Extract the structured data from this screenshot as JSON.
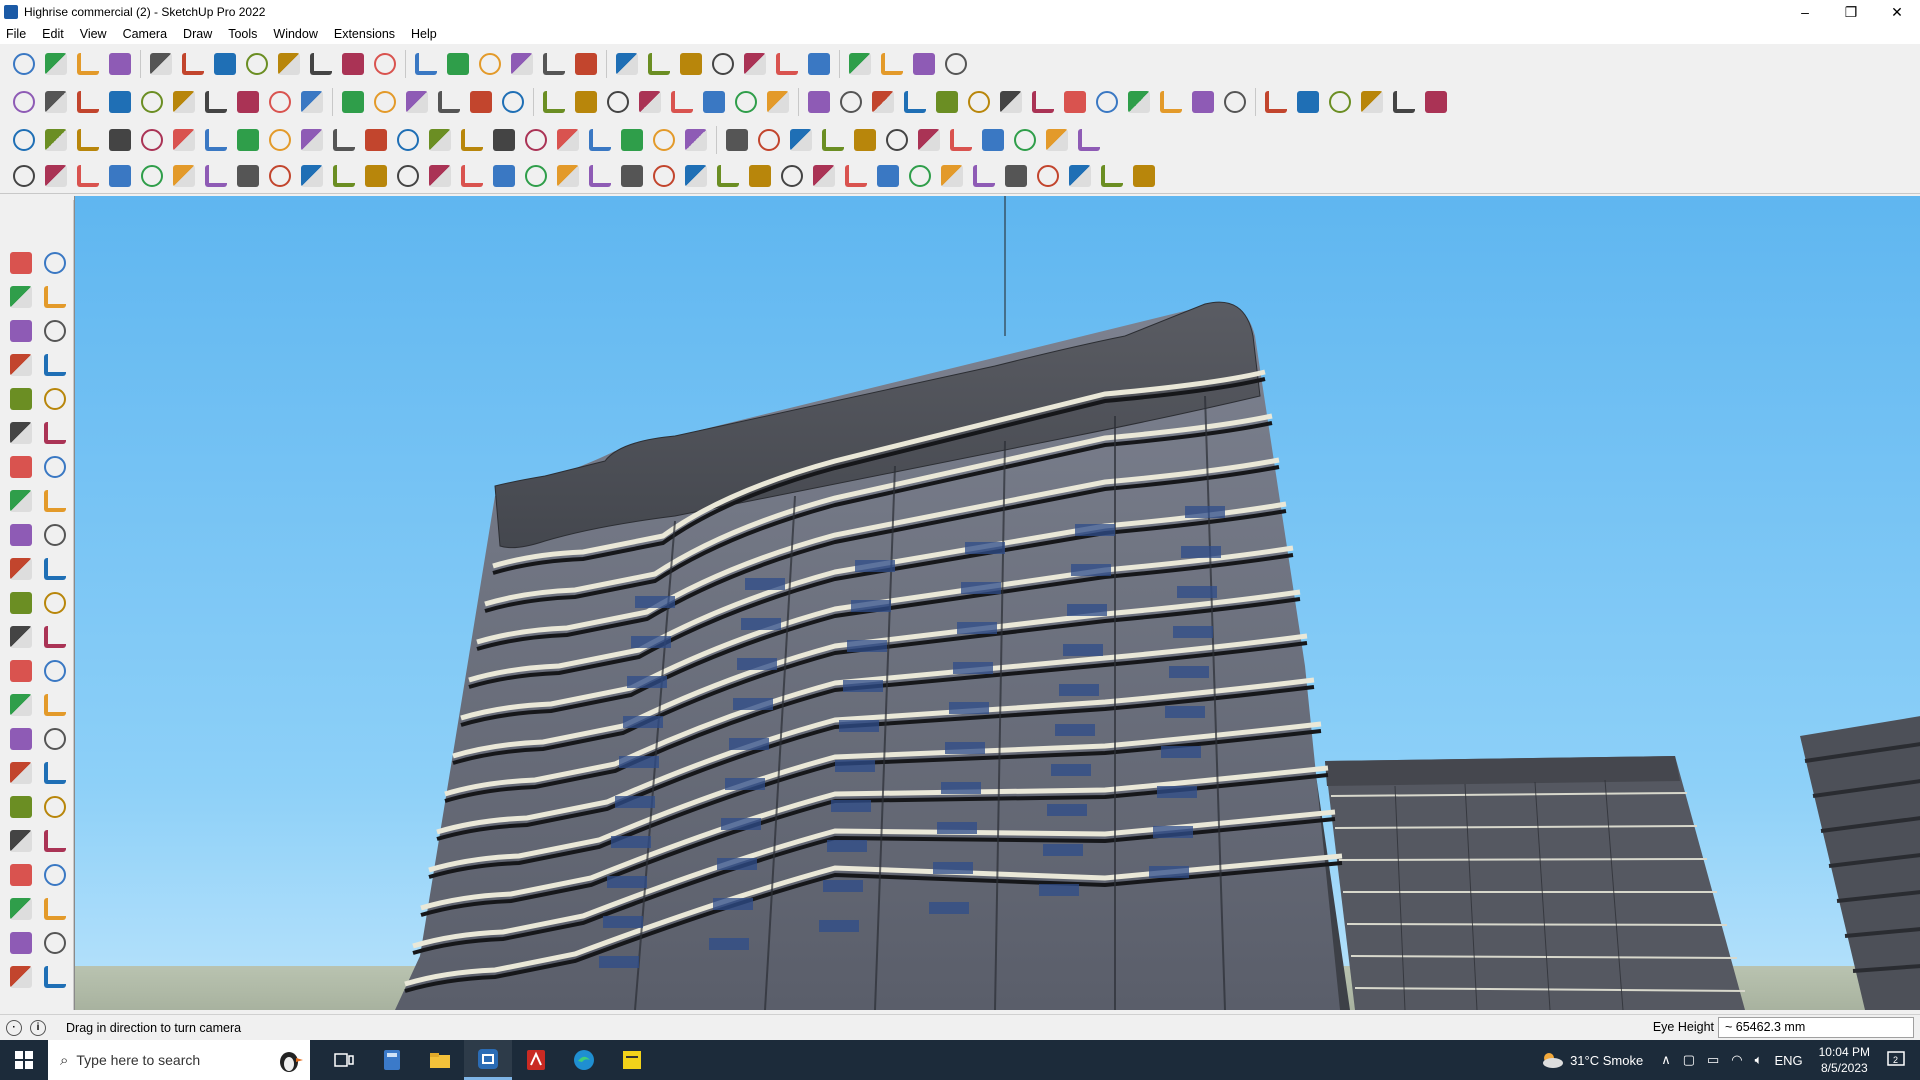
{
  "window": {
    "title": "Highrise commercial (2) - SketchUp Pro 2022",
    "controls": [
      "–",
      "❐",
      "✕"
    ]
  },
  "menu": [
    "File",
    "Edit",
    "View",
    "Camera",
    "Draw",
    "Tools",
    "Window",
    "Extensions",
    "Help"
  ],
  "status": {
    "hint": "Drag in direction to turn camera",
    "measurement_label": "Eye Height",
    "measurement_value": "~ 65462.3 mm"
  },
  "taskbar": {
    "search_placeholder": "Type here to search",
    "weather": "31°C  Smoke",
    "language": "ENG",
    "time": "10:04 PM",
    "date": "8/5/2023"
  },
  "colors": {
    "sky": "#7cc6f4",
    "building_dark": "#4a4d55",
    "taskbar": "#1c2b3a"
  }
}
